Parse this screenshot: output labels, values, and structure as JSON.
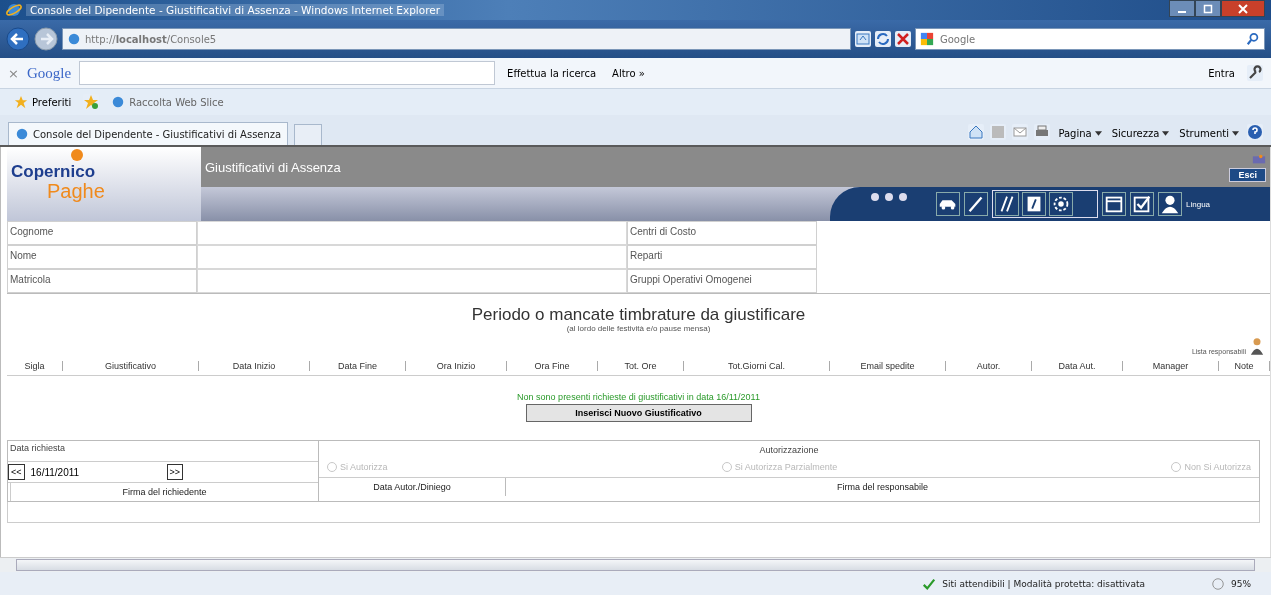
{
  "window": {
    "title": "Console del Dipendente - Giustificativi di Assenza - Windows Internet Explorer"
  },
  "address_bar": {
    "url": "http://**localhost**/Console5"
  },
  "search_box": {
    "placeholder": "Google"
  },
  "google_toolbar": {
    "close": "×",
    "logo": "Google",
    "search_button": "Effettua la ricerca",
    "more": "Altro »",
    "sign_in": "Entra"
  },
  "favorites_bar": {
    "favorites": "Preferiti",
    "web_slice": "Raccolta Web Slice"
  },
  "tabs": [
    {
      "label": "Console del Dipendente - Giustificativi di Assenza",
      "selected": true
    }
  ],
  "command_bar": [
    "Pagina",
    "Sicurezza",
    "Strumenti"
  ],
  "app": {
    "logo_top": "Copernico",
    "logo_bottom": "Paghe",
    "title": "Giustificativi di Assenza",
    "exit": "Esci",
    "language": "Lingua"
  },
  "employee_fields": [
    {
      "label": "Cognome"
    },
    {
      "label": "Nome"
    },
    {
      "label": "Matricola"
    }
  ],
  "org_fields": [
    {
      "label": "Centri di Costo"
    },
    {
      "label": "Reparti"
    },
    {
      "label": "Gruppi Operativi Omogenei"
    }
  ],
  "section": {
    "title": "Periodo o mancate timbrature da giustificare",
    "subtitle": "(al lordo delle festività e/o pause mensa)",
    "responsible_link": "Lista responsabili"
  },
  "table": {
    "columns": [
      "Sigla",
      "Giustificativo",
      "Data Inizio",
      "Data Fine",
      "Ora Inizio",
      "Ora Fine",
      "Tot. Ore",
      "Tot.Giorni Cal.",
      "Email spedite",
      "Autor.",
      "Data Aut.",
      "Manager",
      "Note"
    ],
    "empty_message": "Non sono presenti richieste di giustificativi in data 16/11/2011",
    "new_button": "Inserisci Nuovo Giustificativo"
  },
  "request": {
    "date_label": "Data richiesta",
    "prev": "<<",
    "date": "16/11/2011",
    "next": ">>",
    "signature": "Firma del richiedente"
  },
  "authorization": {
    "title": "Autorizzazione",
    "options": [
      {
        "label": "Si Autorizza",
        "selected": false,
        "disabled": true
      },
      {
        "label": "Si Autorizza Parzialmente",
        "selected": false,
        "disabled": true
      },
      {
        "label": "Non Si Autorizza",
        "selected": false,
        "disabled": true
      }
    ],
    "date_label": "Data Autor./Diniego",
    "signature": "Firma del responsabile"
  },
  "status_bar": {
    "zone": "Siti attendibili | Modalità protetta: disattivata",
    "zoom": "95%"
  }
}
